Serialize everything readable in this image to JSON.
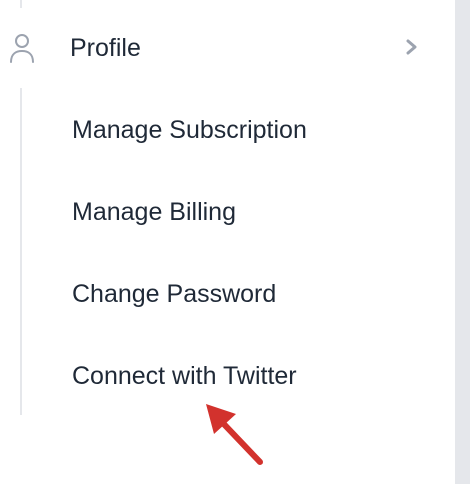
{
  "menu": {
    "profile": {
      "label": "Profile",
      "icon": "user-icon",
      "expand_icon": "chevron-right-icon"
    },
    "sub_items": [
      {
        "label": "Manage Subscription"
      },
      {
        "label": "Manage Billing"
      },
      {
        "label": "Change Password"
      },
      {
        "label": "Connect with Twitter"
      }
    ]
  },
  "annotation": {
    "icon": "arrow-pointer-icon",
    "color": "#d2322d"
  },
  "colors": {
    "text": "#1f2937",
    "icon": "#9ca3af",
    "tree_line": "#e5e7eb",
    "gutter": "#e5e7eb"
  }
}
